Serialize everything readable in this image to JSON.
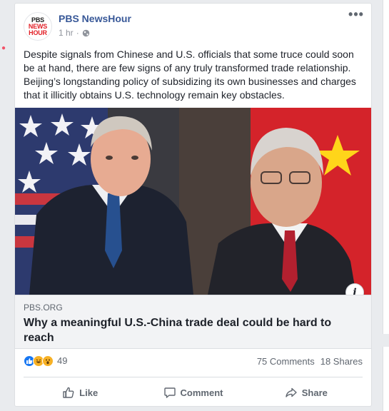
{
  "post": {
    "page_name": "PBS NewsHour",
    "avatar_text": [
      "PBS",
      "NEWS",
      "HOUR"
    ],
    "time": "1 hr",
    "more_label": "•••",
    "text": "Despite signals from Chinese and U.S. officials that some truce could soon be at hand, there are few signs of any truly transformed trade relationship. Beijing’s longstanding policy of subsidizing its own businesses and charges that it illicitly obtains U.S. technology remain key obstacles.",
    "info_label": "i"
  },
  "link": {
    "domain": "PBS.ORG",
    "headline": "Why a meaningful U.S.-China trade deal could be hard to reach"
  },
  "stats": {
    "reaction_icons": [
      "like-icon",
      "haha-icon",
      "wow-icon"
    ],
    "reaction_count": "49",
    "comments": "75 Comments",
    "shares": "18 Shares"
  },
  "actions": {
    "like": "Like",
    "comment": "Comment",
    "share": "Share"
  },
  "colors": {
    "page_name": "#385898",
    "like_blue": "#1877f2",
    "emoji_yellow": "#f7b125",
    "text": "#1d2129",
    "muted": "#606770"
  }
}
